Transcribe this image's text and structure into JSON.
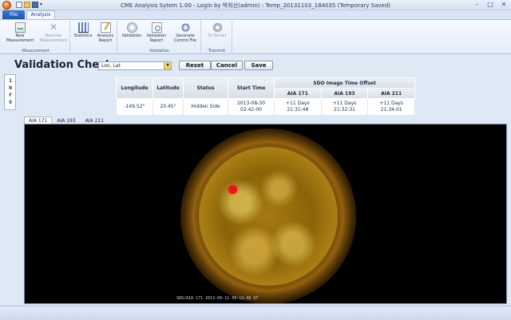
{
  "window": {
    "title": "CME Analysis Sytem 1.00 - Login by 박희선(admin) : Temp_20131103_184035 (Temporary Saved)",
    "controls": [
      "–",
      "□",
      "✕"
    ]
  },
  "ribbon_tabs": {
    "file": "File",
    "analysis": "Analysis"
  },
  "ribbon": {
    "measurement": {
      "label": "Measurement",
      "new": "New Measurement",
      "remove": "Remove Measurement"
    },
    "tools": {
      "statistics": "Statistics",
      "analysis_report": "Analysis Report"
    },
    "validation": {
      "label": "Validation",
      "validation": "Validation",
      "validation_report": "Validation Report",
      "generate": "Generate Control File"
    },
    "transmit": {
      "label": "Transmit",
      "to_server": "To Server"
    }
  },
  "side_panel": {
    "info": "INFO"
  },
  "page": {
    "title": "Validation Check",
    "combo_value": "Lon, Lat",
    "reset": "Reset",
    "cancel": "Cancel",
    "save": "Save"
  },
  "table": {
    "headers": {
      "longitude": "Longitude",
      "latitude": "Latitude",
      "status": "Status",
      "start_time": "Start Time",
      "offset_group": "SDO Image Time Offset",
      "aia171": "AIA 171",
      "aia193": "AIA 193",
      "aia211": "AIA 211"
    },
    "row": {
      "longitude": "-149.52°",
      "latitude": "20.45°",
      "status": "Hidden Side",
      "start_date": "2013-08-30",
      "start_clock": "02:42:00",
      "aia171_days": "+11 Days",
      "aia171_time": "21:31:48",
      "aia193_days": "+11 Days",
      "aia193_time": "21:32:31",
      "aia211_days": "+11 Days",
      "aia211_time": "21:34:01"
    }
  },
  "image_tabs": [
    "AIA 171",
    "AIA 193",
    "AIA 211"
  ],
  "image": {
    "caption": "SDO/AIA  171    2013-09-11 00:13:48 UT",
    "marker_color": "#e8141a"
  }
}
